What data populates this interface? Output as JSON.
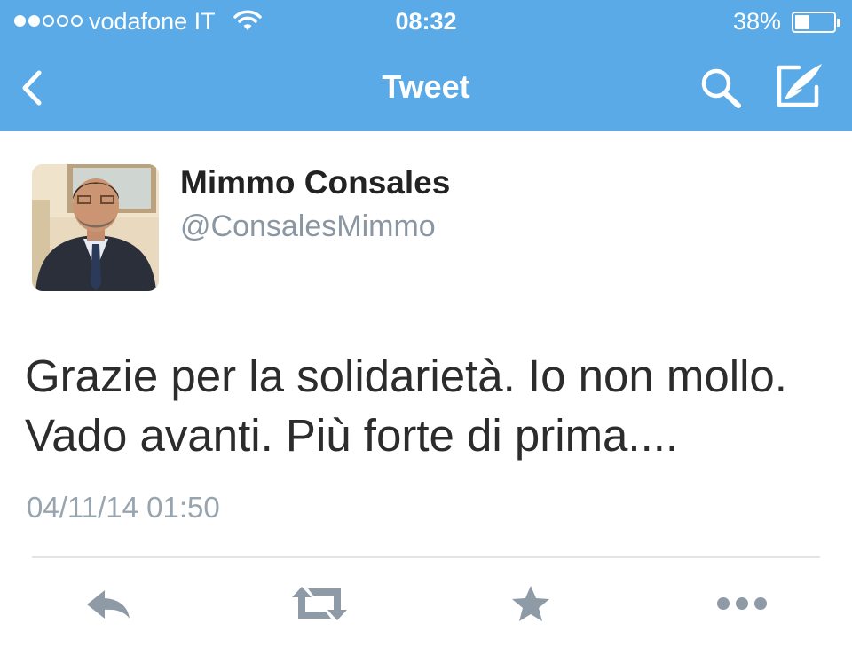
{
  "status_bar": {
    "carrier": "vodafone IT",
    "time": "08:32",
    "battery": "38%",
    "battery_level": 0.38,
    "signal_bars_filled": 2,
    "signal_bars_total": 5
  },
  "nav": {
    "title": "Tweet",
    "back_icon": "back-chevron-icon",
    "search_icon": "search-icon",
    "compose_icon": "compose-tweet-icon"
  },
  "tweet": {
    "author_name": "Mimmo Consales",
    "author_handle": "@ConsalesMimmo",
    "text": "Grazie per la solidarietà. Io non mollo. Vado avanti. Più forte di prima....",
    "timestamp": "04/11/14 01:50"
  },
  "actions": {
    "icons": [
      "reply-icon",
      "retweet-icon",
      "favorite-star-icon",
      "more-dots-icon"
    ]
  },
  "colors": {
    "bar_blue": "#5aaae8",
    "action_gray": "#8e9aa6",
    "muted_text": "#98a4ae"
  }
}
